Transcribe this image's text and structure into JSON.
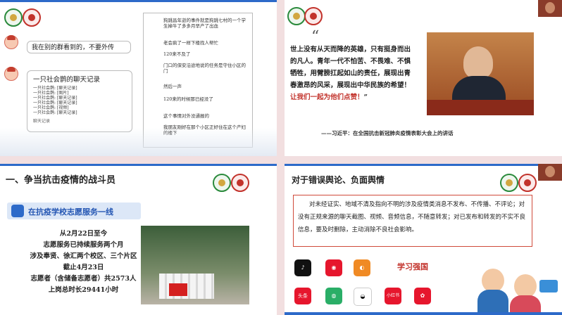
{
  "tile1": {
    "my_message": "我在别的群看到的，不要外传",
    "chat_title": "一只社会鹊的聊天记录",
    "records": [
      "一只社会鹊: [聊天记录]",
      "一只社会鹊: [图片]",
      "一只社会鹊: [聊天记录]",
      "一只社会鹊: [聊天记录]",
      "一只社会鹊: [视频]",
      "一只社会鹊: [聊天记录]"
    ],
    "records_footer": "聊天记录",
    "panel_lines": [
      "狗跳昌年逝的事件就是狗跳七村的一个学生掉牛了多多月早产了出血",
      "老会疯了一样下楼找人帮忙",
      "120来不及了",
      "门口的保安沿途地说的任务是守住小区的门",
      "然后一声",
      "120来的时候那已经没了",
      "这个事情对外没通报的",
      "我朋友刚好在那个小区正好住在这个产妇的楼下"
    ]
  },
  "tile2": {
    "open_quote": "“",
    "quote_p1": "世上没有从天而降的英雄，只有挺身而出的凡人。青年一代不怕苦、不畏难、不惧牺牲，用臂膀扛起如山的责任，展现出青春激昂的风采，展现出中华民族的希望！",
    "quote_p2": "让我们一起为他们点赞！",
    "quote_end": "”",
    "attribution": "——习近平：在全国抗击新冠肺炎疫情表彰大会上的讲话"
  },
  "tile3": {
    "section_title": "一、争当抗击疫情的战斗员",
    "banner": "在抗疫学校志愿服务一线",
    "stats": [
      "从2月22日至今",
      "志愿服务已持续服务两个月",
      "涉及奉贤、徐汇两个校区、三个片区",
      "截止4月23日",
      "志愿者（含储备志愿者）共2573人",
      "上岗总时长29441小时"
    ]
  },
  "tile4": {
    "section_title": "对于错误舆论、负面舆情",
    "box_text": "对未经证实、地域不清及指向不明的涉及疫情类消息不发布、不传播、不评论；对没有正规来源的聊天截图、视频、音频信息，不随意转发；对已发布和转发的不实不良信息，要及时删除，主动消除不良社会影响。",
    "apps": [
      "头条",
      "小红书"
    ],
    "brand": "学习强国"
  },
  "colors": {
    "accent": "#2d6ac9",
    "highlight": "#c2322b"
  }
}
